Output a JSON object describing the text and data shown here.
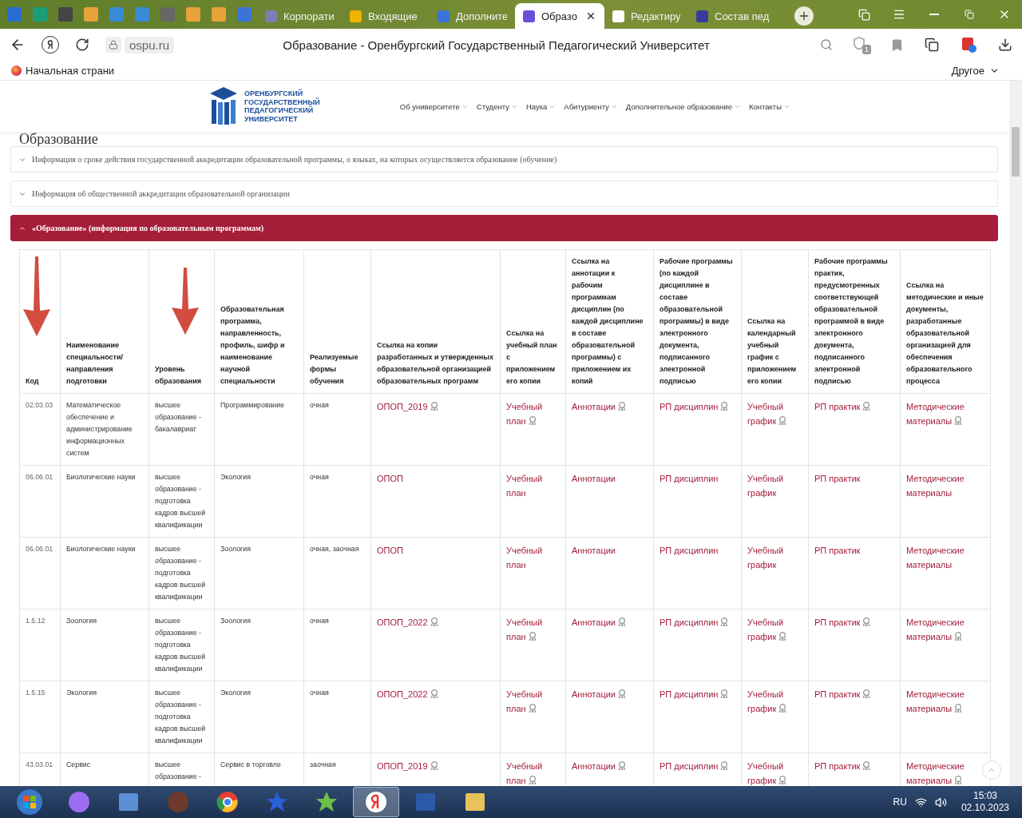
{
  "browser": {
    "tabs": [
      {
        "title": "Корпорати",
        "selected": false
      },
      {
        "title": "Входящие",
        "selected": false
      },
      {
        "title": "Дополните",
        "selected": false
      },
      {
        "title": "Образо",
        "selected": true
      },
      {
        "title": "Редактиру",
        "selected": false
      },
      {
        "title": "Состав пед",
        "selected": false
      }
    ],
    "address": "ospu.ru",
    "page_title": "Образование - Оренбургский Государственный Педагогический Университет",
    "bookmarks": [
      "Начальная страни"
    ],
    "other_bookmarks": "Другое",
    "notification_count": "1"
  },
  "site": {
    "logo_lines": [
      "ОРЕНБУРГСКИЙ",
      "ГОСУДАРСТВЕННЫЙ",
      "ПЕДАГОГИЧЕСКИЙ",
      "УНИВЕРСИТЕТ"
    ],
    "nav": [
      "Об университете",
      "Студенту",
      "Наука",
      "Абитуриенту",
      "Дополнительное образование",
      "Контакты"
    ]
  },
  "heading": "Образование",
  "accordions": [
    {
      "title": "Информация о сроке действия государственной аккредитации образовательной программы, о языках, на которых осуществляется образование (обучение)",
      "expanded": false
    },
    {
      "title": "Информация об общественной аккредитации образовательной организации",
      "expanded": false
    },
    {
      "title": "«Образование» (информация по образовательным программам)",
      "expanded": true
    }
  ],
  "table": {
    "columns": [
      "Код",
      "Наименование специальности/ направления подготовки",
      "Уровень образования",
      "Образовательная программа, направленность, профиль, шифр и наименование научной специальности",
      "Реализуемые формы обучения",
      "Ссылка на копии разработанных и утвержденных образовательной организацией образовательных программ",
      "Ссылка на учебный план с приложением его копии",
      "Ссылка на аннотации к рабочим программам дисциплин (по каждой дисциплине в составе образовательной программы) с приложением их копий",
      "Рабочие программы (по каждой дисциплине в составе образовательной программы) в виде электронного документа, подписанного электронной подписью",
      "Ссылка на календарный учебный график с приложением его копии",
      "Рабочие программы практик, предусмотренных соответствующей образовательной программой в виде электронного документа, подписанного электронной подписью",
      "Ссылка на методические и иные документы, разработанные образовательной организацией для обеспечения образовательного процесса"
    ],
    "rows": [
      {
        "code": "02.03.03",
        "name": "Математическое обеспечение и администрирование информационных систем",
        "level": "высшее образование - бакалавриат",
        "program": "Программирование",
        "forms": "очная",
        "links": [
          {
            "text": "ОПОП_2019",
            "signed": true
          },
          {
            "text": "Учебный план",
            "signed": true
          },
          {
            "text": "Аннотации",
            "signed": true
          },
          {
            "text": "РП дисциплин",
            "signed": true
          },
          {
            "text": "Учебный график",
            "signed": true
          },
          {
            "text": "РП практик",
            "signed": true
          },
          {
            "text": "Методические материалы",
            "signed": true
          }
        ]
      },
      {
        "code": "06.06.01",
        "name": "Биологические науки",
        "level": "высшее образование - подготовка кадров высшей квалификации",
        "program": "Экология",
        "forms": "очная",
        "links": [
          {
            "text": "ОПОП",
            "signed": false
          },
          {
            "text": "Учебный план",
            "signed": false
          },
          {
            "text": "Аннотации",
            "signed": false
          },
          {
            "text": "РП дисциплин",
            "signed": false
          },
          {
            "text": "Учебный график",
            "signed": false
          },
          {
            "text": "РП практик",
            "signed": false
          },
          {
            "text": "Методические материалы",
            "signed": false
          }
        ]
      },
      {
        "code": "06.06.01",
        "name": "Биологические науки",
        "level": "высшее образование - подготовка кадров высшей квалификации",
        "program": "Зоология",
        "forms": "очная, заочная",
        "links": [
          {
            "text": "ОПОП",
            "signed": false
          },
          {
            "text": "Учебный план",
            "signed": false
          },
          {
            "text": "Аннотации",
            "signed": false
          },
          {
            "text": "РП дисциплин",
            "signed": false
          },
          {
            "text": "Учебный график",
            "signed": false
          },
          {
            "text": "РП практик",
            "signed": false
          },
          {
            "text": "Методические материалы",
            "signed": false
          }
        ]
      },
      {
        "code": "1.5.12",
        "name": "Зоология",
        "level": "высшее образование - подготовка кадров высшей квалификации",
        "program": "Зоология",
        "forms": "очная",
        "links": [
          {
            "text": "ОПОП_2022",
            "signed": true
          },
          {
            "text": "Учебный план",
            "signed": true
          },
          {
            "text": "Аннотации",
            "signed": true
          },
          {
            "text": "РП дисциплин",
            "signed": true
          },
          {
            "text": "Учебный график",
            "signed": true
          },
          {
            "text": "РП практик",
            "signed": true
          },
          {
            "text": "Методические материалы",
            "signed": true
          }
        ]
      },
      {
        "code": "1.5.15",
        "name": "Экология",
        "level": "высшее образование - подготовка кадров высшей квалификации",
        "program": "Экология",
        "forms": "очная",
        "links": [
          {
            "text": "ОПОП_2022",
            "signed": true
          },
          {
            "text": "Учебный план",
            "signed": true
          },
          {
            "text": "Аннотации",
            "signed": true
          },
          {
            "text": "РП дисциплин",
            "signed": true
          },
          {
            "text": "Учебный график",
            "signed": true
          },
          {
            "text": "РП практик",
            "signed": true
          },
          {
            "text": "Методические материалы",
            "signed": true
          }
        ]
      },
      {
        "code": "43.03.01",
        "name": "Сервис",
        "level": "высшее образование -",
        "program": "Сервис в торговле",
        "forms": "заочная",
        "links": [
          {
            "text": "ОПОП_2019",
            "signed": true
          },
          {
            "text": "Учебный план",
            "signed": true
          },
          {
            "text": "Аннотации",
            "signed": true
          },
          {
            "text": "РП дисциплин",
            "signed": true
          },
          {
            "text": "Учебный график",
            "signed": true
          },
          {
            "text": "РП практик",
            "signed": true
          },
          {
            "text": "Методические материалы",
            "signed": true
          }
        ]
      }
    ]
  },
  "taskbar": {
    "language": "RU",
    "time": "15:03",
    "date": "02.10.2023"
  }
}
